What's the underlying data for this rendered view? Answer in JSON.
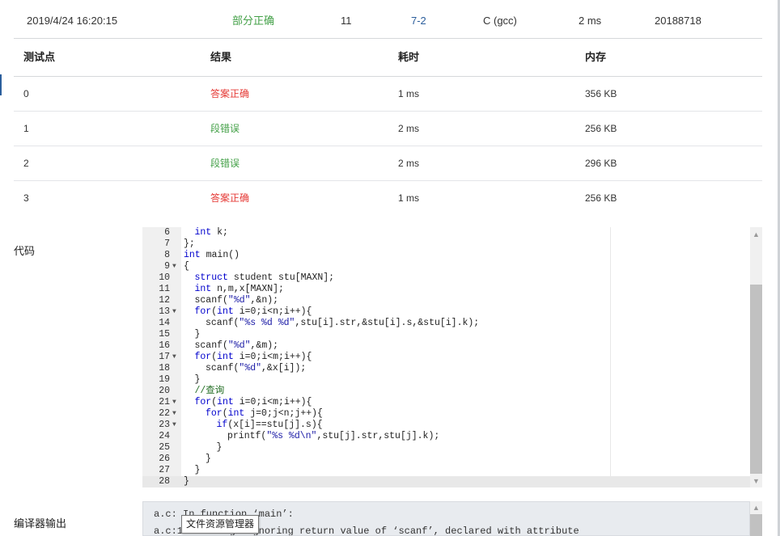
{
  "submission": {
    "time": "2019/4/24 16:20:15",
    "status": "部分正确",
    "score": "11",
    "problem": "7-2",
    "compiler": "C (gcc)",
    "runtime": "2 ms",
    "user": "20188718"
  },
  "testcase_table": {
    "headers": [
      "测试点",
      "结果",
      "耗时",
      "内存"
    ],
    "rows": [
      {
        "id": "0",
        "result": "答案正确",
        "time": "1 ms",
        "memory": "356 KB"
      },
      {
        "id": "1",
        "result": "段错误",
        "time": "2 ms",
        "memory": "256 KB"
      },
      {
        "id": "2",
        "result": "段错误",
        "time": "2 ms",
        "memory": "296 KB"
      },
      {
        "id": "3",
        "result": "答案正确",
        "time": "1 ms",
        "memory": "256 KB"
      }
    ]
  },
  "code_label": "代码",
  "compiler_output_label": "编译器输出",
  "code_lines": [
    {
      "n": "6",
      "fold": false,
      "indent": 1,
      "text": "int k;"
    },
    {
      "n": "7",
      "fold": false,
      "indent": 0,
      "text": "};"
    },
    {
      "n": "8",
      "fold": false,
      "indent": 0,
      "text": "int main()"
    },
    {
      "n": "9",
      "fold": true,
      "indent": 0,
      "text": "{"
    },
    {
      "n": "10",
      "fold": false,
      "indent": 1,
      "text": "struct student stu[MAXN];"
    },
    {
      "n": "11",
      "fold": false,
      "indent": 1,
      "text": "int n,m,x[MAXN];"
    },
    {
      "n": "12",
      "fold": false,
      "indent": 1,
      "text": "scanf(\"%d\",&n);"
    },
    {
      "n": "13",
      "fold": true,
      "indent": 1,
      "text": "for(int i=0;i<n;i++){"
    },
    {
      "n": "14",
      "fold": false,
      "indent": 2,
      "text": "scanf(\"%s %d %d\",stu[i].str,&stu[i].s,&stu[i].k);"
    },
    {
      "n": "15",
      "fold": false,
      "indent": 1,
      "text": "}"
    },
    {
      "n": "16",
      "fold": false,
      "indent": 1,
      "text": "scanf(\"%d\",&m);"
    },
    {
      "n": "17",
      "fold": true,
      "indent": 1,
      "text": "for(int i=0;i<m;i++){"
    },
    {
      "n": "18",
      "fold": false,
      "indent": 2,
      "text": "scanf(\"%d\",&x[i]);"
    },
    {
      "n": "19",
      "fold": false,
      "indent": 1,
      "text": "}"
    },
    {
      "n": "20",
      "fold": false,
      "indent": 1,
      "text": "//查询"
    },
    {
      "n": "21",
      "fold": true,
      "indent": 1,
      "text": "for(int i=0;i<m;i++){"
    },
    {
      "n": "22",
      "fold": true,
      "indent": 2,
      "text": "for(int j=0;j<n;j++){"
    },
    {
      "n": "23",
      "fold": true,
      "indent": 3,
      "text": "if(x[i]==stu[j].s){"
    },
    {
      "n": "24",
      "fold": false,
      "indent": 4,
      "text": "printf(\"%s %d\\n\",stu[j].str,stu[j].k);"
    },
    {
      "n": "25",
      "fold": false,
      "indent": 3,
      "text": "}"
    },
    {
      "n": "26",
      "fold": false,
      "indent": 2,
      "text": "}"
    },
    {
      "n": "27",
      "fold": false,
      "indent": 1,
      "text": "}"
    },
    {
      "n": "28",
      "fold": false,
      "indent": 0,
      "text": "}"
    }
  ],
  "compiler_output": [
    "a.c: In function ‘main’:",
    "a.c:1: warning: ignoring return value of ‘scanf’, declared with attribute"
  ],
  "tooltip": "文件资源管理器",
  "colors": {
    "correct": "#43a047",
    "wrong": "#e53935",
    "link": "#2b5e9c",
    "keyword": "#0000cd",
    "string": "#1a1aa6",
    "comment": "#236e24"
  },
  "icons": {
    "fold": "triangle-down",
    "scroll_up": "chevron-up",
    "scroll_down": "chevron-down"
  }
}
